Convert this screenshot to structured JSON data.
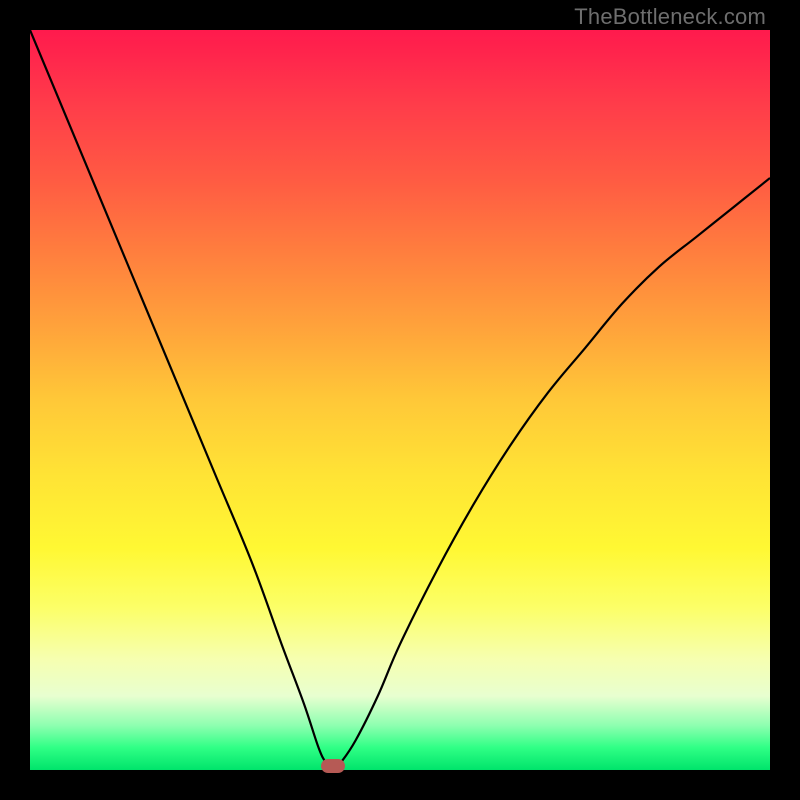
{
  "watermark": "TheBottleneck.com",
  "colors": {
    "frame": "#000000",
    "curve": "#000000",
    "marker": "#b65a55",
    "gradient_top": "#ff1a4d",
    "gradient_bottom": "#00e46b"
  },
  "chart_data": {
    "type": "line",
    "title": "",
    "xlabel": "",
    "ylabel": "",
    "xlim": [
      0,
      100
    ],
    "ylim": [
      0,
      100
    ],
    "grid": false,
    "legend": false,
    "series": [
      {
        "name": "bottleneck-curve",
        "x": [
          0,
          5,
          10,
          15,
          20,
          25,
          30,
          34,
          37,
          39,
          40,
          41,
          42,
          44,
          47,
          50,
          55,
          60,
          65,
          70,
          75,
          80,
          85,
          90,
          95,
          100
        ],
        "values": [
          100,
          88,
          76,
          64,
          52,
          40,
          28,
          17,
          9,
          3,
          1,
          0,
          1,
          4,
          10,
          17,
          27,
          36,
          44,
          51,
          57,
          63,
          68,
          72,
          76,
          80
        ]
      }
    ],
    "annotations": [
      {
        "name": "optimal-marker",
        "x": 41,
        "y": 0
      }
    ]
  }
}
